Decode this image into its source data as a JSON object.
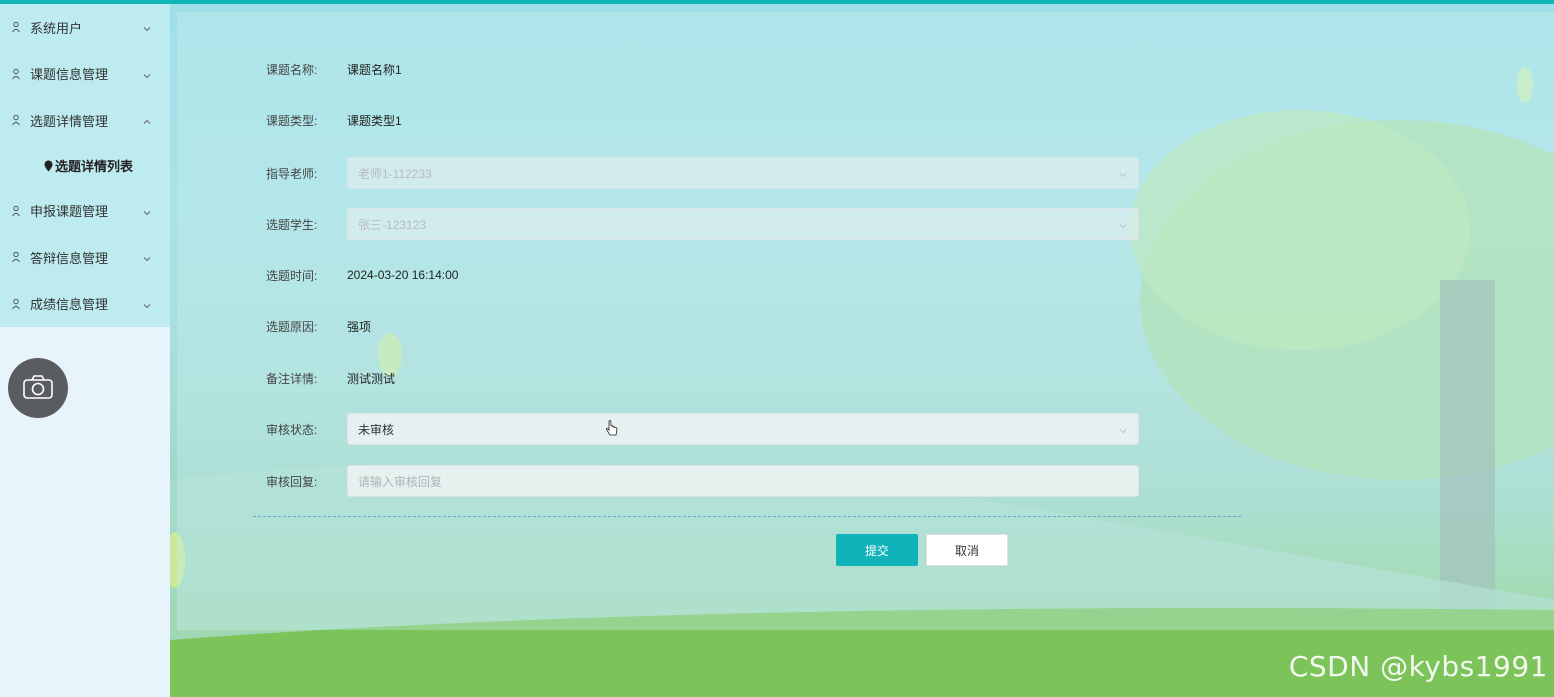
{
  "sidebar": {
    "items": [
      {
        "label": "系统用户",
        "expanded": false
      },
      {
        "label": "课题信息管理",
        "expanded": false
      },
      {
        "label": "选题详情管理",
        "expanded": true
      },
      {
        "label": "申报课题管理",
        "expanded": false
      },
      {
        "label": "答辩信息管理",
        "expanded": false
      },
      {
        "label": "成绩信息管理",
        "expanded": false
      }
    ],
    "sub_item": "选题详情列表"
  },
  "form": {
    "topic_name": {
      "label": "课题名称:",
      "value": "课题名称1"
    },
    "topic_type": {
      "label": "课题类型:",
      "value": "课题类型1"
    },
    "teacher": {
      "label": "指导老师:",
      "value": "老师1-112233"
    },
    "student": {
      "label": "选题学生:",
      "value": "张三-123123"
    },
    "select_time": {
      "label": "选题时间:",
      "value": "2024-03-20 16:14:00"
    },
    "reason": {
      "label": "选题原因:",
      "value": "强项"
    },
    "remark": {
      "label": "备注详情:",
      "value": "测试测试"
    },
    "review_status": {
      "label": "审核状态:",
      "value": "未审核"
    },
    "review_reply": {
      "label": "审核回复:",
      "placeholder": "请输入审核回复"
    }
  },
  "buttons": {
    "submit": "提交",
    "cancel": "取消"
  },
  "watermark": "CSDN @kybs1991",
  "colors": {
    "accent": "#10b3ba",
    "topbar": "#10b6b8",
    "sidebar_menu": "#bdebf0"
  }
}
